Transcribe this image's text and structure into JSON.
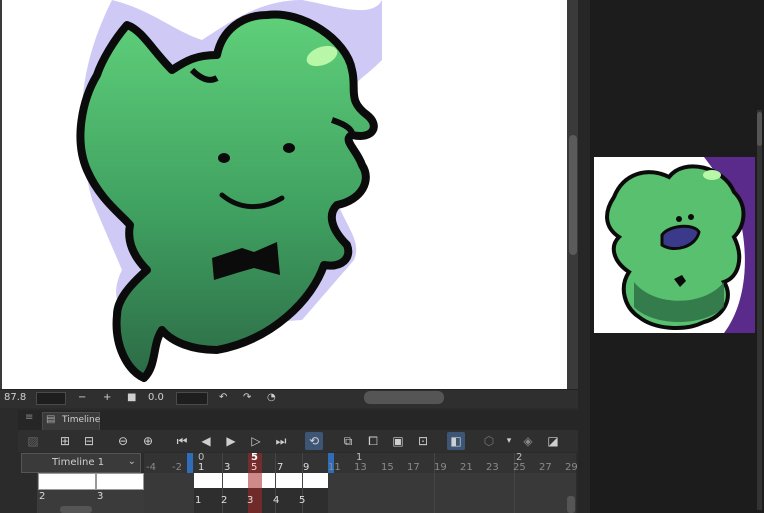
{
  "statusbar": {
    "zoom": "87.8",
    "zoom_out": "−",
    "zoom_in": "+",
    "reset": "■",
    "rotation": "0.0",
    "undo": "↶",
    "redo": "↷",
    "history": "◔"
  },
  "timeline": {
    "tab_label": "Timeline",
    "selector_value": "Timeline 1",
    "ruler_top": [
      "0",
      "5",
      "1",
      "2"
    ],
    "ruler_labels": [
      "-4",
      "-2",
      "1",
      "3",
      "5",
      "7",
      "9",
      "11",
      "13",
      "15",
      "17",
      "19",
      "21",
      "23",
      "25",
      "27",
      "29"
    ],
    "track_labels": [
      "2",
      "3"
    ],
    "frame_numbers": [
      "1",
      "2",
      "3",
      "4",
      "5"
    ]
  },
  "colors": {
    "character_green": "#4fbf6b",
    "character_dark": "#2e6b45",
    "shadow_lavender": "#c9c3f5",
    "playhead": "#c03a3a",
    "marker_blue": "#2f6db8",
    "active_button": "#3e5676"
  }
}
